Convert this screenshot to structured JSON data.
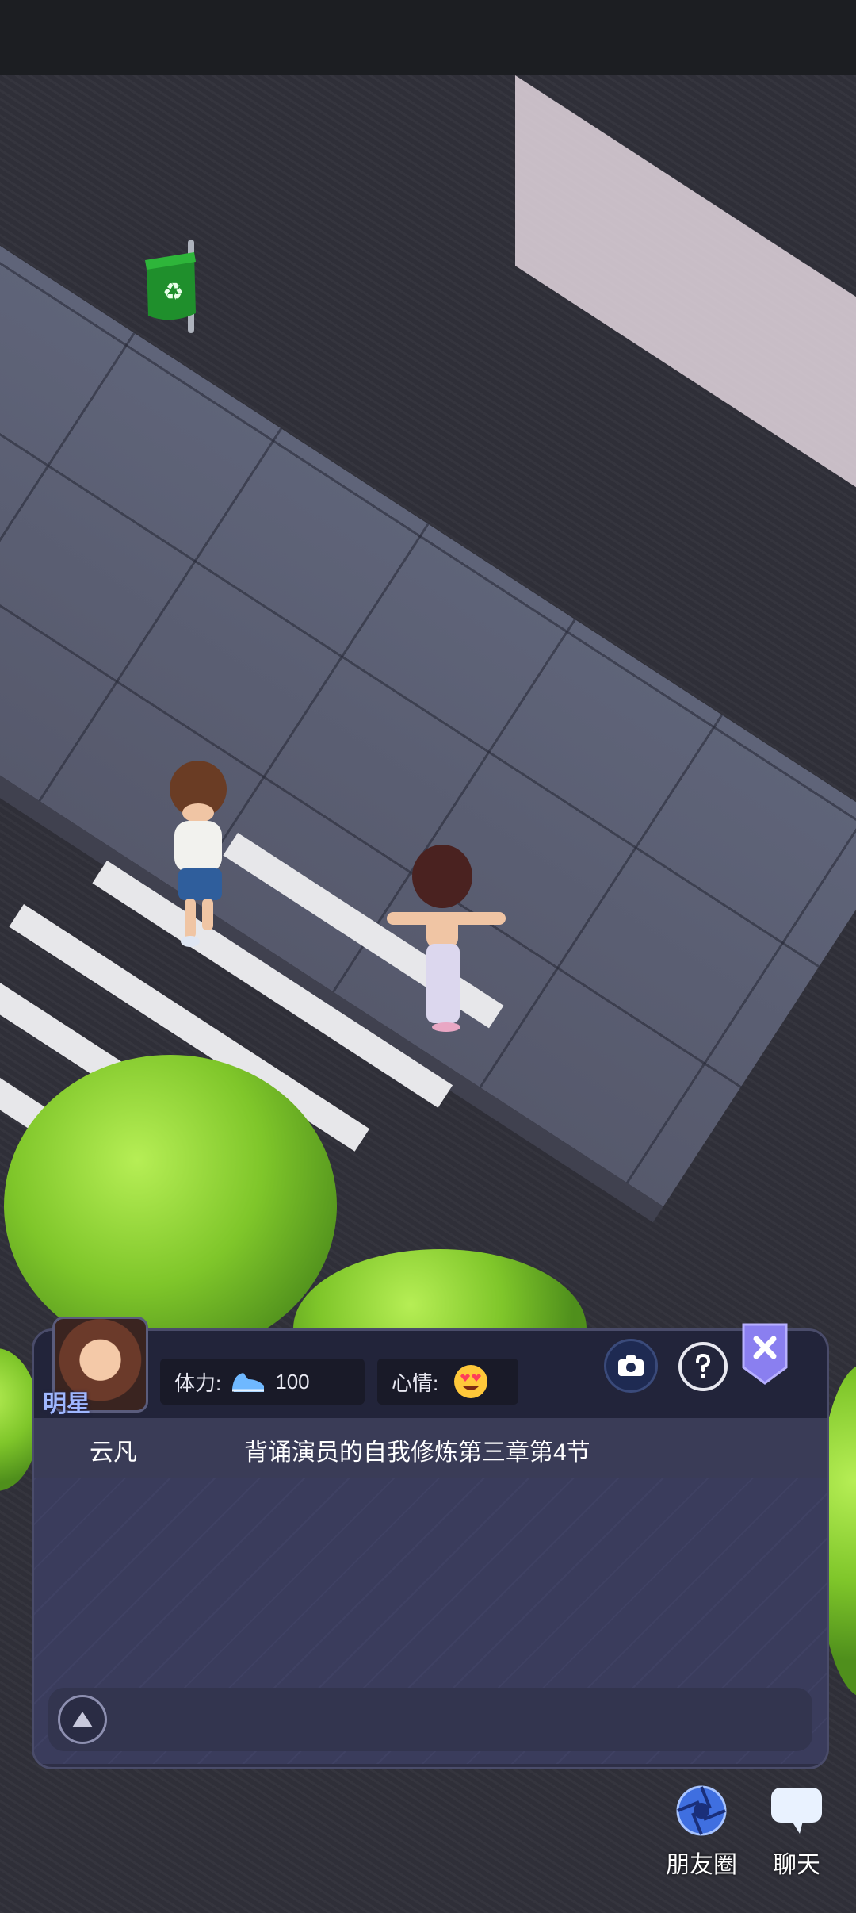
{
  "player": {
    "title_badge": "明星",
    "stamina_label": "体力:",
    "stamina_value": "100",
    "mood_label": "心情:"
  },
  "chat": {
    "speaker": "云凡",
    "message": "背诵演员的自我修炼第三章第4节"
  },
  "buttons": {
    "moments_label": "朋友圈",
    "chat_label": "聊天"
  },
  "icons": {
    "stamina": "sneaker-icon",
    "mood": "heart-eyes-emoji-icon",
    "camera": "camera-icon",
    "help": "question-icon",
    "close": "close-icon",
    "expand": "expand-up-icon",
    "moments": "aperture-icon",
    "chat": "speech-bubble-icon"
  },
  "colors": {
    "panel": "#2e2f47",
    "accent": "#8a7ff0",
    "badge_text": "#9fb7ff"
  }
}
